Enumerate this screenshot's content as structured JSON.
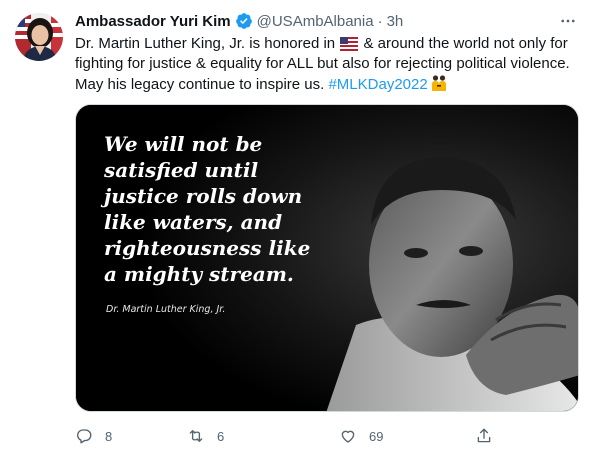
{
  "author": {
    "display_name": "Ambassador Yuri Kim",
    "handle": "@USAmbAlbania",
    "separator": "·",
    "time": "3h"
  },
  "tweet": {
    "text_part1": "Dr. Martin Luther King, Jr. is honored in",
    "text_part2": "& around the world not only for fighting for justice & equality for ALL but also for rejecting political violence. May his legacy continue to inspire us.",
    "hashtag": "#MLKDay2022"
  },
  "media": {
    "quote_lines": [
      "We will not be",
      "satisfied until",
      "justice rolls down",
      "like waters, and",
      "righteousness like",
      "a mighty stream."
    ],
    "attribution": "Dr. Martin Luther King, Jr."
  },
  "actions": {
    "reply_count": "8",
    "retweet_count": "6",
    "like_count": "69"
  },
  "icons": {
    "verified": "verified-badge-icon",
    "more": "more-options-icon",
    "flag": "us-flag-icon",
    "hashtag_emoji": "people-holding-hands-icon",
    "reply": "reply-icon",
    "retweet": "retweet-icon",
    "like": "heart-icon",
    "share": "share-icon"
  },
  "colors": {
    "link": "#1d9bf0",
    "verified": "#1d9bf0",
    "secondary_text": "#536471",
    "primary_text": "#0f1419"
  }
}
